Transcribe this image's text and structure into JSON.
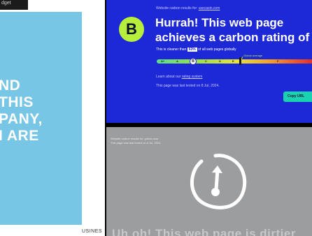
{
  "left_panel": {
    "top_snippet": "dget",
    "quote_lines": [
      "ND",
      "THIS",
      "PANY,",
      "I ARE"
    ],
    "bottom_caption": "USINES"
  },
  "carbon_card": {
    "caption_prefix": "Website carbon results for:",
    "caption_link": "usecasin.com",
    "grade": "B",
    "headline_line1": "Hurrah! This web page",
    "headline_line2": "achieves a carbon rating of B",
    "cleaner_prefix": "This is cleaner than",
    "cleaner_pct": "63%",
    "cleaner_suffix": "of all web pages globally",
    "global_average_label": "Global average",
    "scale_letters": [
      "A+",
      "A",
      "B",
      "C",
      "D",
      "E",
      "F"
    ],
    "current_marker": "B",
    "learn_prefix": "Learn about our",
    "learn_link": "rating system",
    "tested_text": "This page was last tested on 8 Jul, 2024.",
    "copy_button": "Copy URL",
    "colors": {
      "background": "#1d28d6",
      "grade_badge": "#b7ee3c",
      "copy_button": "#19d3b0"
    }
  },
  "dirty_card": {
    "caption_line1": "Website carbon results for: yahoo.com",
    "caption_line2": "This page was last tested on 8 Jul, 2024.",
    "gauge_icon": "gauge-icon",
    "headline": "Uh oh! This web page is dirtier"
  }
}
